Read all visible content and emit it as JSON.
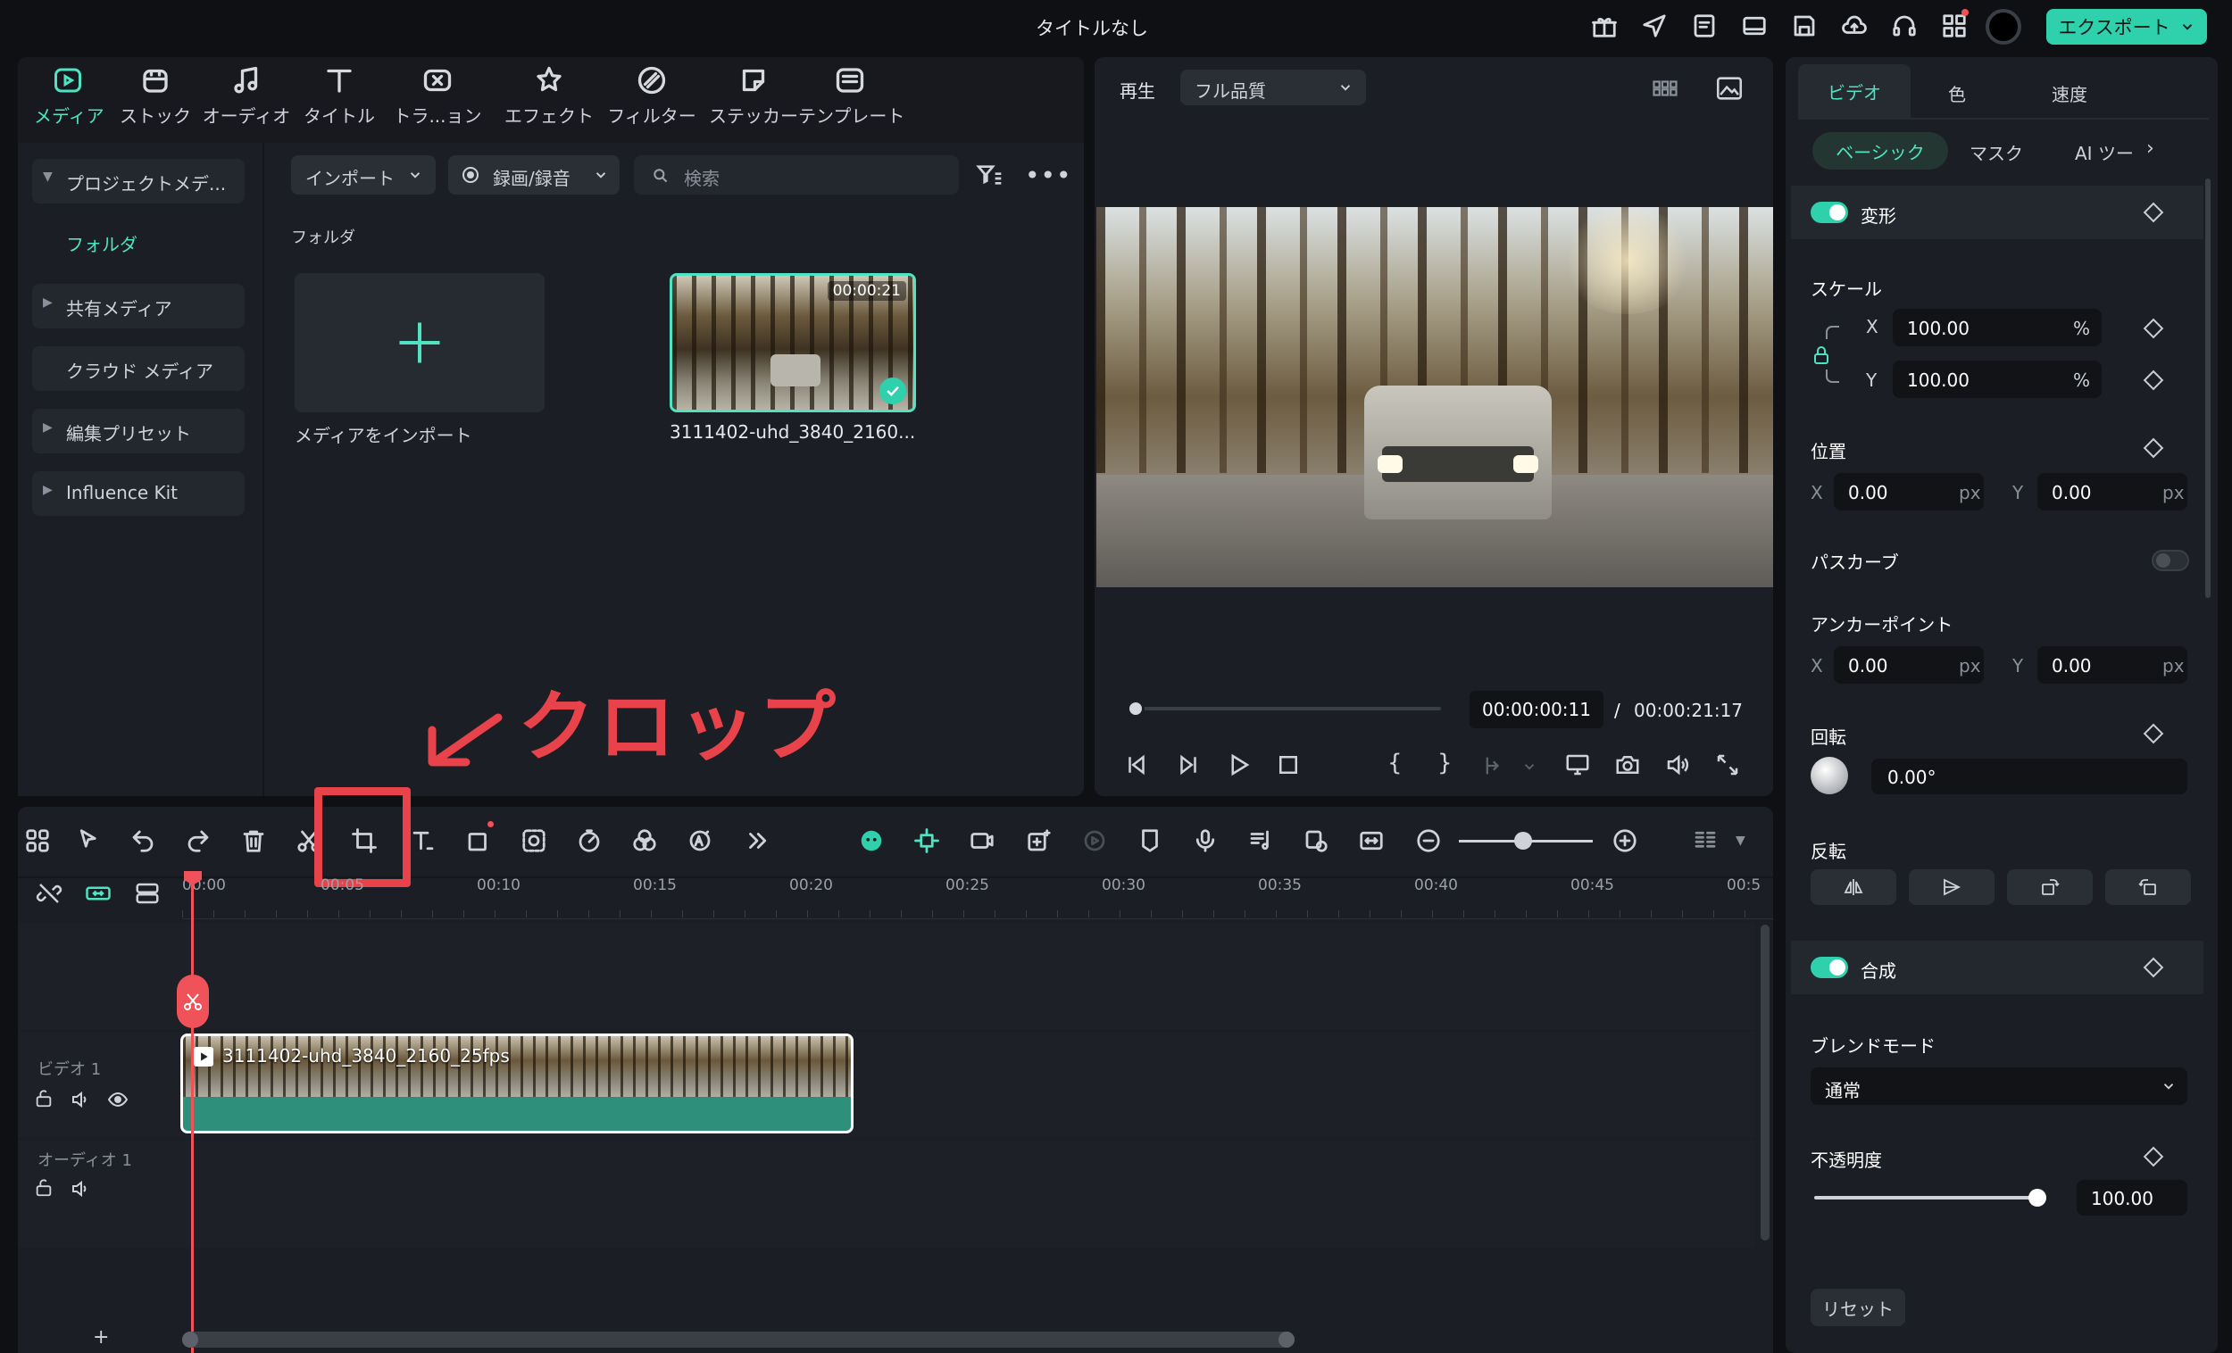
{
  "window": {
    "title": "タイトルなし",
    "export_label": "エクスポート"
  },
  "media_tabs": [
    {
      "label": "メディア"
    },
    {
      "label": "ストック"
    },
    {
      "label": "オーディオ"
    },
    {
      "label": "タイトル"
    },
    {
      "label": "トラ...ョン"
    },
    {
      "label": "エフェクト"
    },
    {
      "label": "フィルター"
    },
    {
      "label": "ステッカー"
    },
    {
      "label": "テンプレート"
    }
  ],
  "sidebar": {
    "items": [
      {
        "label": "プロジェクトメデ..."
      },
      {
        "label": "フォルダ"
      },
      {
        "label": "共有メディア"
      },
      {
        "label": "クラウド メディア"
      },
      {
        "label": "編集プリセット"
      },
      {
        "label": "Influence Kit"
      }
    ]
  },
  "media_toolbar": {
    "import_label": "インポート",
    "record_label": "録画/録音",
    "search_placeholder": "検索"
  },
  "media_area": {
    "folder_label": "フォルダ",
    "import_tile_label": "メディアをインポート",
    "clip": {
      "name": "3111402-uhd_3840_2160...",
      "duration": "00:00:21"
    }
  },
  "preview": {
    "play_label": "再生",
    "quality_label": "フル品質",
    "current_time": "00:00:00:11",
    "separator": "/",
    "total_time": "00:00:21:17",
    "progress": 0.01
  },
  "annotation": {
    "label": "クロップ",
    "color": "#e8424a"
  },
  "timeline": {
    "ruler": [
      "00:00",
      "00:05",
      "00:10",
      "00:15",
      "00:20",
      "00:25",
      "00:30",
      "00:35",
      "00:40",
      "00:45",
      "00:5"
    ],
    "tracks": [
      {
        "label": "ビデオ 1"
      },
      {
        "label": "オーディオ 1"
      }
    ],
    "clip_label": "3111402-uhd_3840_2160_25fps",
    "add_label": "+"
  },
  "inspector": {
    "tabs": [
      {
        "label": "ビデオ"
      },
      {
        "label": "色"
      },
      {
        "label": "速度"
      }
    ],
    "subtabs": [
      {
        "label": "ベーシック"
      },
      {
        "label": "マスク"
      },
      {
        "label": "AI ツー"
      }
    ],
    "transform_label": "変形",
    "scale_label": "スケール",
    "scale_x": "100.00",
    "scale_y": "100.00",
    "percent": "%",
    "position_label": "位置",
    "pos_x": "0.00",
    "pos_y": "0.00",
    "px": "px",
    "path_curve_label": "パスカーブ",
    "anchor_label": "アンカーポイント",
    "anchor_x": "0.00",
    "anchor_y": "0.00",
    "rotation_label": "回転",
    "rotation_value": "0.00°",
    "flip_label": "反転",
    "composite_label": "合成",
    "blend_label": "ブレンドモード",
    "blend_value": "通常",
    "opacity_label": "不透明度",
    "opacity_value": "100.00",
    "opacity_level": 1.0,
    "reset_label": "リセット",
    "axis_x": "X",
    "axis_y": "Y"
  },
  "colors": {
    "accent": "#4fe3c1",
    "toggle_on": "#2fd1ad",
    "playhead": "#f0525a",
    "clip": "#2e8f7a"
  }
}
